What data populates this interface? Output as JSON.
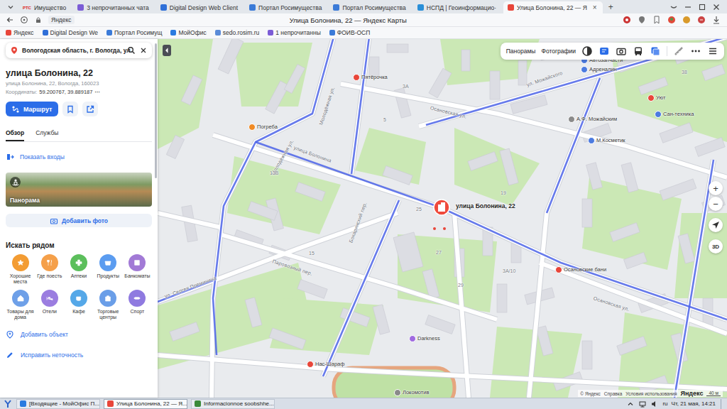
{
  "browser": {
    "tabs": [
      {
        "favicon_text": "РТС",
        "label": "Имущество",
        "selected": false
      },
      {
        "label": "3 непрочитанных чата",
        "selected": false
      },
      {
        "label": "Digital Design Web Client",
        "selected": false
      },
      {
        "label": "Портал Росимущества",
        "selected": false
      },
      {
        "label": "Портал Росимущества",
        "selected": false
      },
      {
        "label": "НСПД | Геоинформацио·",
        "selected": false
      },
      {
        "label": "Улица Болонина, 22 — Я",
        "selected": true
      }
    ],
    "close_tab": "×",
    "new_tab": "+",
    "address": {
      "site": "Яндекс",
      "title": "Улица Болонина, 22 — Яндекс Карты"
    },
    "bookmarks": [
      "Яндекс",
      "Digital Design We",
      "Портал Росимущ",
      "МойОфис",
      "sedo.rosim.ru",
      "1 непрочитанны",
      "ФОИВ-ОСП"
    ]
  },
  "sidebar": {
    "search": {
      "value": "Вологодская область, г. Вологда, ул."
    },
    "place": {
      "title": "улица Болонина, 22",
      "address": "улица Болонина, 22, Вологда, 160023",
      "coords_label": "Координаты:",
      "coords": "59.200767, 39.889187",
      "more": "···"
    },
    "route_button": "Маршрут",
    "tabs": [
      {
        "label": "Обзор",
        "selected": true
      },
      {
        "label": "Службы",
        "selected": false
      }
    ],
    "show_entrances": "Показать входы",
    "panorama": "Панорама",
    "add_photo": "Добавить фото",
    "nearby_title": "Искать рядом",
    "nearby": [
      {
        "label": "Хорошие места",
        "color": "#f39c33"
      },
      {
        "label": "Где поесть",
        "color": "#f5a04a"
      },
      {
        "label": "Аптеки",
        "color": "#5cbf5c"
      },
      {
        "label": "Продукты",
        "color": "#5b9cf0"
      },
      {
        "label": "Банкоматы",
        "color": "#a27ad6"
      },
      {
        "label": "Товары для дома",
        "color": "#6ea0e8"
      },
      {
        "label": "Отели",
        "color": "#9b7de0"
      },
      {
        "label": "Кафе",
        "color": "#55a8e8"
      },
      {
        "label": "Торговые центры",
        "color": "#6a9ee8"
      },
      {
        "label": "Спорт",
        "color": "#8f7ae0"
      }
    ],
    "actions": [
      "Добавить объект",
      "Исправить неточность"
    ]
  },
  "map": {
    "top_buttons": [
      "Панорамы",
      "Фотографии"
    ],
    "pin_label": "улица Болонина, 22",
    "labels": [
      {
        "text": "ул. Можайского",
        "kind": "street"
      },
      {
        "text": "Осановская ул.",
        "kind": "street"
      },
      {
        "text": "Осановская ул.",
        "kind": "street"
      },
      {
        "text": "улица Болонина",
        "kind": "street"
      },
      {
        "text": "Молодёжная ул.",
        "kind": "street"
      },
      {
        "text": "Молодёжная ул.",
        "kind": "street"
      },
      {
        "text": "Паровозный пер.",
        "kind": "street"
      },
      {
        "text": "ул. Сергея Преминина",
        "kind": "street"
      },
      {
        "text": "Бокаринский пер.",
        "kind": "street"
      },
      {
        "text": "Пятёрочка",
        "kind": "poi",
        "color": "#e8463a"
      },
      {
        "text": "Автозапчасти",
        "kind": "poi",
        "color": "#4c7be0"
      },
      {
        "text": "Адреналин",
        "kind": "poi",
        "color": "#4c7be0"
      },
      {
        "text": "Сан-техника",
        "kind": "poi",
        "color": "#4c7be0"
      },
      {
        "text": "А.Ф. Можайским",
        "kind": "poi",
        "color": "#8a8a8a"
      },
      {
        "text": "М.Косметик",
        "kind": "poi",
        "color": "#4c7be0"
      },
      {
        "text": "Погреба",
        "kind": "poi",
        "color": "#f08a24"
      },
      {
        "text": "Осановские бани",
        "kind": "poi",
        "color": "#e8463a"
      },
      {
        "text": "Darkness",
        "kind": "poi",
        "color": "#a06be0"
      },
      {
        "text": "Нас-Шараф",
        "kind": "poi",
        "color": "#e8463a"
      },
      {
        "text": "Локомотив",
        "kind": "poi",
        "color": "#8a8a8a"
      },
      {
        "text": "Уют",
        "kind": "poi",
        "color": "#e8463a"
      },
      {
        "text": "25",
        "kind": "house"
      },
      {
        "text": "3А",
        "kind": "house"
      },
      {
        "text": "38",
        "kind": "house"
      },
      {
        "text": "13В",
        "kind": "house"
      },
      {
        "text": "15",
        "kind": "house"
      },
      {
        "text": "27",
        "kind": "house"
      },
      {
        "text": "29",
        "kind": "house"
      },
      {
        "text": "19",
        "kind": "house"
      },
      {
        "text": "3А/10",
        "kind": "house"
      },
      {
        "text": "5",
        "kind": "house"
      }
    ],
    "zoom_in": "+",
    "zoom_out": "−",
    "mode_3d": "3D",
    "copyright": "© Яндекс",
    "links": [
      "Справка",
      "Условия использования"
    ],
    "logo": "Яндекс",
    "scale": "40 м"
  },
  "taskbar": {
    "items": [
      {
        "label": "[Входящие - МойОфис П...",
        "selected": false
      },
      {
        "label": "Улица Болонина, 22 — Я...",
        "selected": true
      },
      {
        "label": "Informacionnoe soobshhe...",
        "selected": false
      }
    ],
    "lang": "ru",
    "clock": "Чт, 21 мая, 14:21"
  }
}
